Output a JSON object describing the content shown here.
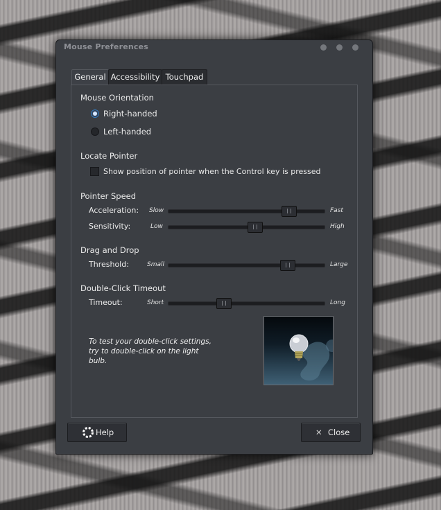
{
  "window": {
    "title": "Mouse Preferences"
  },
  "tabs": [
    {
      "label": "General",
      "active": true
    },
    {
      "label": "Accessibility",
      "active": false
    },
    {
      "label": "Touchpad",
      "active": false
    }
  ],
  "orientation": {
    "heading": "Mouse Orientation",
    "right_label": "Right-handed",
    "left_label": "Left-handed",
    "selected": "Right-handed"
  },
  "locate": {
    "heading": "Locate Pointer",
    "checkbox_label": "Show position of pointer when the Control key is pressed",
    "checked": false
  },
  "speed": {
    "heading": "Pointer Speed",
    "acceleration": {
      "label": "Acceleration:",
      "low": "Slow",
      "high": "Fast",
      "value": 0.77
    },
    "sensitivity": {
      "label": "Sensitivity:",
      "low": "Low",
      "high": "High",
      "value": 0.55
    }
  },
  "drag": {
    "heading": "Drag and Drop",
    "threshold": {
      "label": "Threshold:",
      "low": "Small",
      "high": "Large",
      "value": 0.76
    }
  },
  "dclick": {
    "heading": "Double-Click Timeout",
    "timeout": {
      "label": "Timeout:",
      "low": "Short",
      "high": "Long",
      "value": 0.35
    },
    "test_text": "To test your double-click settings, try to double-click on the light bulb."
  },
  "buttons": {
    "help": "Help",
    "close": "Close"
  },
  "colors": {
    "accent": "#2f79c0",
    "background": "#3b3e43"
  }
}
